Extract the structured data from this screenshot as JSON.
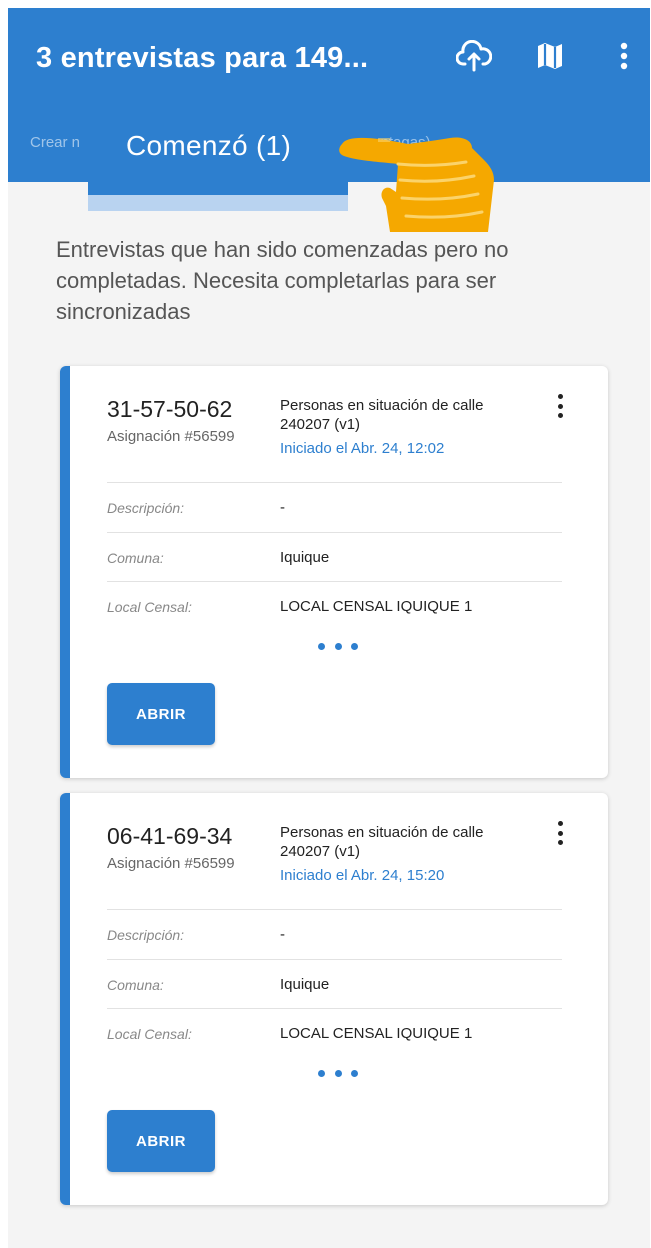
{
  "appbar": {
    "title": "3 entrevistas para 149...",
    "icons": [
      "cloud-sync-icon",
      "map-icon",
      "more-vert-icon"
    ]
  },
  "tabs": {
    "left_label": "Crear n",
    "active_label": "Comenzó (1)",
    "right_label": "...ntagas)"
  },
  "intro_text": "Entrevistas que han sido comenzadas pero no completadas. Necesita completarlas para ser sincronizadas",
  "cards": [
    {
      "code": "31-57-50-62",
      "assignment": "Asignación #56599",
      "survey": "Personas en situación de calle 240207 (v1)",
      "started": "Iniciado el Abr. 24, 12:02",
      "fields": [
        {
          "label": "Descripción:",
          "value": "-"
        },
        {
          "label": "Comuna:",
          "value": "Iquique"
        },
        {
          "label": "Local Censal:",
          "value": "LOCAL CENSAL IQUIQUE 1"
        }
      ],
      "button": "ABRIR"
    },
    {
      "code": "06-41-69-34",
      "assignment": "Asignación #56599",
      "survey": "Personas en situación de calle 240207 (v1)",
      "started": "Iniciado el Abr. 24, 15:20",
      "fields": [
        {
          "label": "Descripción:",
          "value": "-"
        },
        {
          "label": "Comuna:",
          "value": "Iquique"
        },
        {
          "label": "Local Censal:",
          "value": "LOCAL CENSAL IQUIQUE 1"
        }
      ],
      "button": "ABRIR"
    }
  ],
  "colors": {
    "primary": "#2d7fcf",
    "indicator": "#b9d3f0",
    "hand": "#f5a800"
  }
}
